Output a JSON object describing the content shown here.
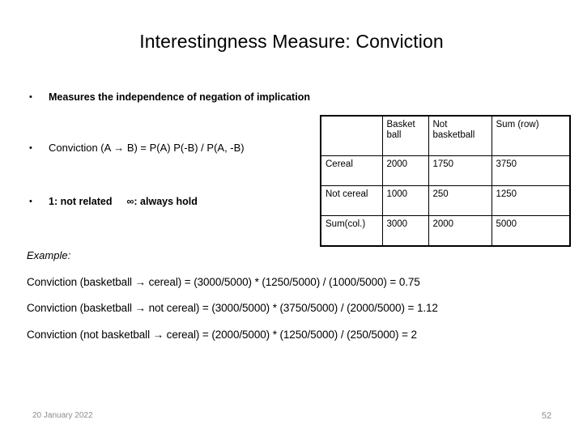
{
  "slide": {
    "title": "Interestingness Measure: Conviction",
    "bullets": [
      {
        "marker": "•",
        "text": "Measures the independence of negation of implication"
      },
      {
        "marker": "•",
        "text": "Conviction (A → B) =  P(A) P(-B) / P(A, -B)"
      },
      {
        "marker": "•",
        "text_a": "1: not related",
        "text_b": "∞: always hold"
      }
    ],
    "example_label": "Example:",
    "calculations": [
      "Conviction (basketball → cereal) = (3000/5000) * (1250/5000) / (1000/5000) = 0.75",
      "Conviction (basketball → not cereal) = (3000/5000) * (3750/5000) / (2000/5000) = 1.12",
      "Conviction (not basketball →  cereal) = (2000/5000) * (1250/5000) / (250/5000) = 2"
    ],
    "footer": {
      "date": "20 January 2022",
      "page_number": "52"
    }
  },
  "chart_data": {
    "type": "table",
    "title": "Contingency table: basketball vs cereal",
    "columns": [
      "",
      "Basket ball",
      "Not basketball",
      "Sum  (row)"
    ],
    "rows": [
      {
        "label": "Cereal",
        "values": [
          "2000",
          "1750",
          "3750"
        ]
      },
      {
        "label": "Not cereal",
        "values": [
          "1000",
          "250",
          "1250"
        ]
      },
      {
        "label": "Sum(col.)",
        "values": [
          "3000",
          "2000",
          "5000"
        ]
      }
    ]
  }
}
